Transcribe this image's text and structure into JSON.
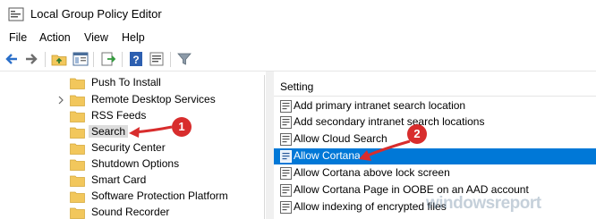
{
  "window": {
    "title": "Local Group Policy Editor"
  },
  "menu": [
    "File",
    "Action",
    "View",
    "Help"
  ],
  "toolbar": {
    "icons": [
      "back-arrow-icon",
      "forward-arrow-icon",
      "up-folder-icon",
      "show-hide-tree-icon",
      "export-list-icon",
      "help-icon",
      "properties-icon",
      "filter-icon"
    ]
  },
  "tree": {
    "items": [
      {
        "label": "Push To Install",
        "expandable": false
      },
      {
        "label": "Remote Desktop Services",
        "expandable": true
      },
      {
        "label": "RSS Feeds",
        "expandable": false
      },
      {
        "label": "Search",
        "expandable": false,
        "selected": true
      },
      {
        "label": "Security Center",
        "expandable": false
      },
      {
        "label": "Shutdown Options",
        "expandable": false
      },
      {
        "label": "Smart Card",
        "expandable": false
      },
      {
        "label": "Software Protection Platform",
        "expandable": false
      },
      {
        "label": "Sound Recorder",
        "expandable": false
      }
    ]
  },
  "settings": {
    "column_header": "Setting",
    "items": [
      {
        "label": "Add primary intranet search location"
      },
      {
        "label": "Add secondary intranet search locations"
      },
      {
        "label": "Allow Cloud Search"
      },
      {
        "label": "Allow Cortana",
        "selected": true
      },
      {
        "label": "Allow Cortana above lock screen"
      },
      {
        "label": "Allow Cortana Page in OOBE on an AAD account"
      },
      {
        "label": "Allow indexing of encrypted files"
      }
    ]
  },
  "annotations": {
    "callout_1": "1",
    "callout_2": "2"
  },
  "watermark": "windowsreport",
  "colors": {
    "selection": "#0078d7",
    "callout": "#d82d2d",
    "folder": "#f2c75c"
  }
}
